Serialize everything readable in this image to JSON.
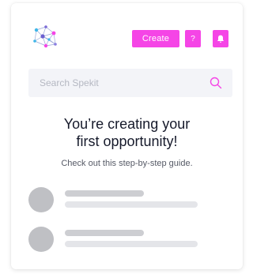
{
  "colors": {
    "accent": "#f545e6",
    "search_bg": "#f3f4f8",
    "skeleton_avatar": "#bfc0c4",
    "skeleton_line_dark": "#cdced2",
    "skeleton_line_light": "#e4e5e9"
  },
  "header": {
    "logo_icon": "spekit-network-logo",
    "create_label": "Create",
    "help_label": "?",
    "notifications_icon": "bell-icon"
  },
  "search": {
    "placeholder": "Search Spekit",
    "value": "",
    "icon": "search-icon"
  },
  "main": {
    "title_line1": "You’re creating your",
    "title_line2": "first opportunity!",
    "subtitle": "Check out this step-by-step guide."
  },
  "placeholder_items": [
    {
      "state": "loading"
    },
    {
      "state": "loading"
    }
  ]
}
